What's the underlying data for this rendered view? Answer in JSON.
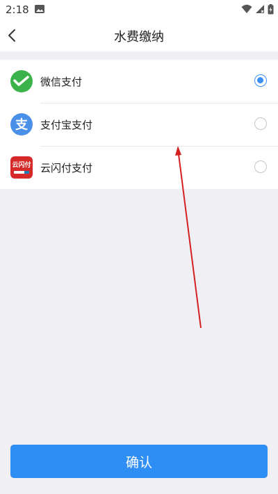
{
  "status_bar": {
    "time": "2:18",
    "icons": [
      "image-icon",
      "wifi-icon",
      "signal-icon",
      "battery-icon"
    ]
  },
  "header": {
    "title": "水费缴纳",
    "back_icon": "back-arrow-icon"
  },
  "payment_methods": [
    {
      "label": "微信支付",
      "icon": "wechat-pay-icon",
      "selected": true
    },
    {
      "label": "支付宝支付",
      "icon": "alipay-icon",
      "selected": false
    },
    {
      "label": "云闪付支付",
      "icon": "unionpay-quickpass-icon",
      "selected": false
    }
  ],
  "unionpay_logo_text": "云闪付",
  "confirm_label": "确认",
  "colors": {
    "accent": "#2f8ef4",
    "background": "#efeff4",
    "wechat": "#3bb34a",
    "alipay": "#4a90e8",
    "unionpay": "#d62a2a",
    "annotation_arrow": "#d42020"
  }
}
